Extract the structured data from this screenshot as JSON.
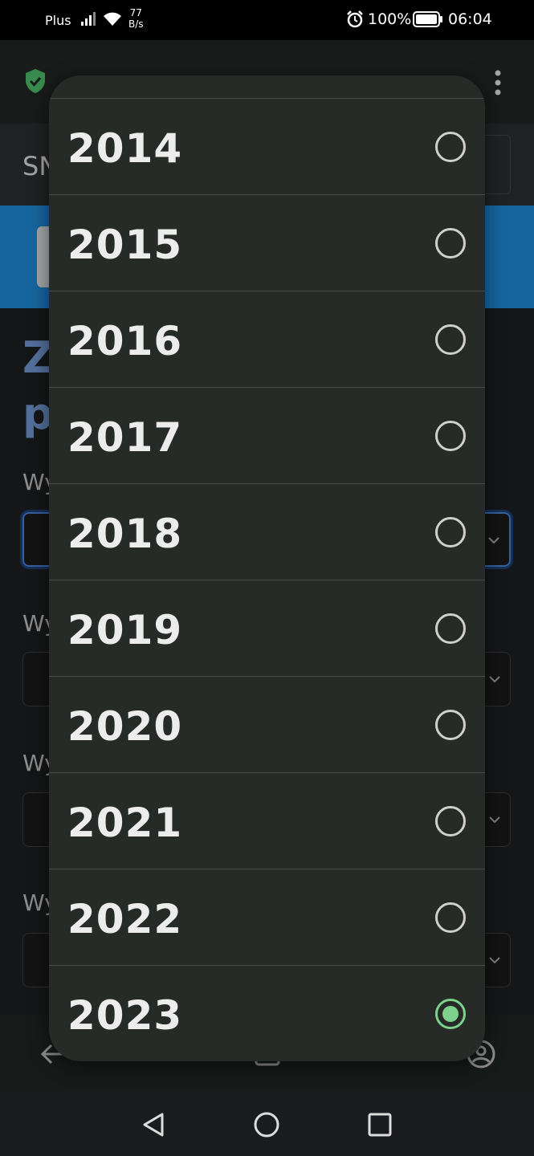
{
  "status_bar": {
    "carrier": "Plus",
    "speed_value": "77",
    "speed_unit": "B/s",
    "battery": "100%",
    "time": "06:04"
  },
  "background_page": {
    "header_text": "SN",
    "title_line1": "Z",
    "title_line2": "p",
    "field_labels": [
      "Wy",
      "Wy",
      "Wy",
      "Wy"
    ]
  },
  "year_picker": {
    "options": [
      {
        "label": "2014",
        "selected": false
      },
      {
        "label": "2015",
        "selected": false
      },
      {
        "label": "2016",
        "selected": false
      },
      {
        "label": "2017",
        "selected": false
      },
      {
        "label": "2018",
        "selected": false
      },
      {
        "label": "2019",
        "selected": false
      },
      {
        "label": "2020",
        "selected": false
      },
      {
        "label": "2021",
        "selected": false
      },
      {
        "label": "2022",
        "selected": false
      },
      {
        "label": "2023",
        "selected": true
      }
    ]
  },
  "colors": {
    "dialog_bg": "#262b27",
    "accent_selected": "#7ed18b",
    "banner": "#1f87d4",
    "title_blue": "#6f95cf"
  },
  "icons": {
    "status": [
      "signal-icon",
      "wifi-icon",
      "alarm-icon",
      "battery-icon"
    ],
    "browser": [
      "shield-check-icon",
      "more-vert-icon"
    ],
    "bottom_nav": [
      "back-arrow-icon",
      "tabs-icon",
      "profile-icon"
    ],
    "system_nav": [
      "back-triangle-icon",
      "home-circle-icon",
      "recents-square-icon"
    ]
  }
}
